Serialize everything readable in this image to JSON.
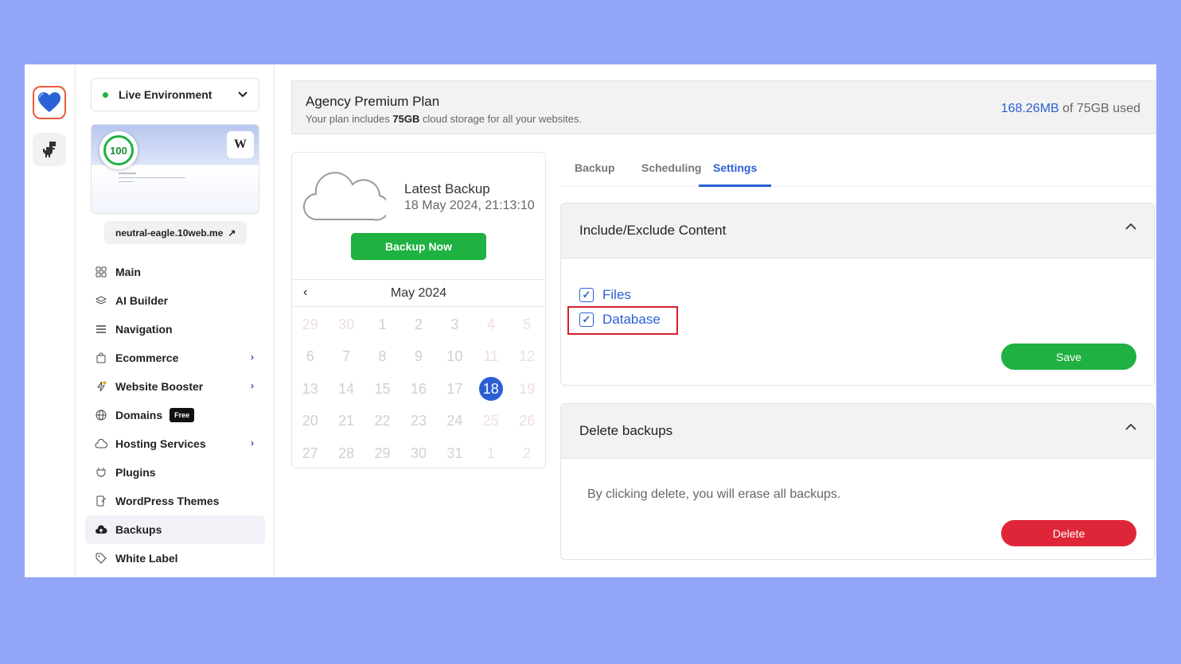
{
  "rail": {
    "items": [
      {
        "name": "heart-site-icon",
        "active": true
      },
      {
        "name": "dino-site-icon",
        "active": false
      }
    ]
  },
  "sidebar": {
    "environment": {
      "label": "Live Environment",
      "status_color": "#1fb141"
    },
    "preview": {
      "score": "100",
      "wp_badge": "W"
    },
    "domain": {
      "label": "neutral-eagle.10web.me",
      "arrow": "↗"
    },
    "items": [
      {
        "label": "Main",
        "icon": "grid-icon"
      },
      {
        "label": "AI Builder",
        "icon": "layers-icon"
      },
      {
        "label": "Navigation",
        "icon": "menu-icon"
      },
      {
        "label": "Ecommerce",
        "icon": "bag-icon",
        "chevron": "›"
      },
      {
        "label": "Website Booster",
        "icon": "bolt-icon",
        "chevron": "›"
      },
      {
        "label": "Domains",
        "icon": "globe-icon",
        "badge": "Free"
      },
      {
        "label": "Hosting Services",
        "icon": "cloud-icon",
        "chevron": "›"
      },
      {
        "label": "Plugins",
        "icon": "plug-icon"
      },
      {
        "label": "WordPress Themes",
        "icon": "brush-icon"
      },
      {
        "label": "Backups",
        "icon": "cloud-upload-icon",
        "active": true
      },
      {
        "label": "White Label",
        "icon": "tag-icon"
      }
    ]
  },
  "plan": {
    "title": "Agency Premium Plan",
    "sub_prefix": "Your plan includes ",
    "sub_bold": "75GB",
    "sub_suffix": " cloud storage for all your websites.",
    "used": "168.26MB",
    "of_total": " of 75GB used"
  },
  "backup": {
    "latest_label": "Latest Backup",
    "latest_date": "18 May 2024, 21:13:10",
    "backup_now": "Backup Now"
  },
  "calendar": {
    "month": "May 2024",
    "prev": "‹",
    "selected": "18",
    "weeks": [
      [
        "29",
        "30",
        "1",
        "2",
        "3",
        "4",
        "5"
      ],
      [
        "6",
        "7",
        "8",
        "9",
        "10",
        "11",
        "12"
      ],
      [
        "13",
        "14",
        "15",
        "16",
        "17",
        "18",
        "19"
      ],
      [
        "20",
        "21",
        "22",
        "23",
        "24",
        "25",
        "26"
      ],
      [
        "27",
        "28",
        "29",
        "30",
        "31",
        "1",
        "2"
      ]
    ]
  },
  "tabs": [
    "Backup",
    "Scheduling",
    "Settings"
  ],
  "active_tab": "Settings",
  "include_exclude": {
    "title": "Include/Exclude Content",
    "files": "Files",
    "database": "Database",
    "save": "Save"
  },
  "delete_backups": {
    "title": "Delete backups",
    "text": "By clicking delete, you will erase all backups.",
    "delete": "Delete"
  },
  "colors": {
    "accent": "#2c5fd4",
    "success": "#1fb141",
    "danger": "#df2638",
    "highlight": "#d51f2c",
    "background": "#93a5f7"
  }
}
